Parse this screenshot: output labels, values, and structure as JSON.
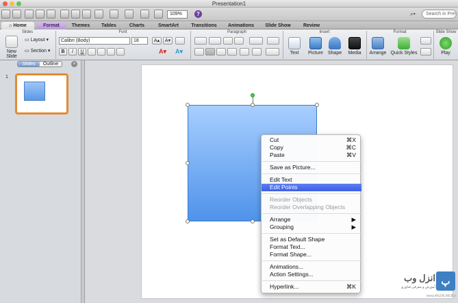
{
  "window": {
    "title": "Presentation1"
  },
  "toolbar": {
    "zoom": "109%",
    "help": "?",
    "search_placeholder": "Search in Presentation"
  },
  "tabs": [
    "Home",
    "Format",
    "Themes",
    "Tables",
    "Charts",
    "SmartArt",
    "Transitions",
    "Animations",
    "Slide Show",
    "Review"
  ],
  "ribbon": {
    "groups": [
      "Slides",
      "Font",
      "Paragraph",
      "Insert",
      "Format",
      "Slide Show"
    ],
    "new_slide": "New Slide",
    "layout": "Layout",
    "section": "Section",
    "font_name": "Calibri (Body)",
    "font_size": "18",
    "text": "Text",
    "picture": "Picture",
    "shape": "Shape",
    "media": "Media",
    "arrange": "Arrange",
    "quick_styles": "Quick Styles",
    "play": "Play"
  },
  "pane": {
    "tab_slides": "Slides",
    "tab_outline": "Outline",
    "slide_number": "1"
  },
  "context_menu": [
    {
      "label": "Cut",
      "shortcut": "⌘X"
    },
    {
      "label": "Copy",
      "shortcut": "⌘C"
    },
    {
      "label": "Paste",
      "shortcut": "⌘V"
    },
    {
      "label": "Save as Picture..."
    },
    {
      "label": "Edit Text"
    },
    {
      "label": "Edit Points",
      "highlighted": true
    },
    {
      "label": "Reorder Objects",
      "disabled": true
    },
    {
      "label": "Reorder Overlapping Objects",
      "disabled": true
    },
    {
      "label": "Arrange",
      "submenu": true
    },
    {
      "label": "Grouping",
      "submenu": true
    },
    {
      "label": "Set as Default Shape"
    },
    {
      "label": "Format Text..."
    },
    {
      "label": "Format Shape..."
    },
    {
      "label": "Animations..."
    },
    {
      "label": "Action Settings..."
    },
    {
      "label": "Hyperlink...",
      "shortcut": "⌘K"
    }
  ],
  "watermark": {
    "logo": "ﭖ",
    "name": "انزل وب",
    "tagline": "آموزش و معرفی فناوری",
    "url": "www.ANZALWEB.ir"
  }
}
